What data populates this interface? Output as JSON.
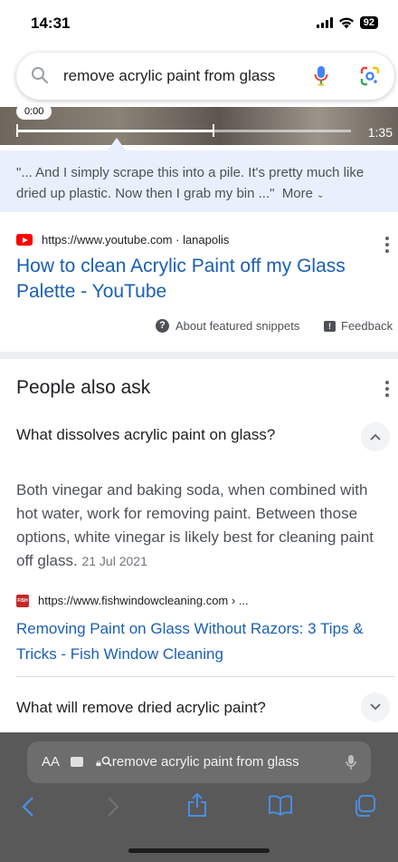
{
  "status_bar": {
    "time": "14:31",
    "battery": "92"
  },
  "search": {
    "query": "remove acrylic paint from glass"
  },
  "video": {
    "current_time": "0:00",
    "duration": "1:35",
    "progress": 0.59
  },
  "snippet": {
    "text": "\"... And I simply scrape this into a pile. It's pretty much like dried up plastic. Now then I grab my bin ...\"",
    "more_label": "More"
  },
  "result": {
    "source": "https://www.youtube.com · lanapolis",
    "title": "How to clean Acrylic Paint off my Glass Palette - YouTube"
  },
  "footer_links": {
    "about": "About featured snippets",
    "feedback": "Feedback"
  },
  "people_also_ask": {
    "heading": "People also ask",
    "q1": "What dissolves acrylic paint on glass?",
    "answer": "Both vinegar and baking soda, when combined with hot water, work for removing paint. Between those options, white vinegar is likely best for cleaning paint off glass.",
    "answer_date": "21 Jul 2021",
    "answer_source": "https://www.fishwindowcleaning.com › ...",
    "answer_title": "Removing Paint on Glass Without Razors: 3 Tips & Tricks - Fish Window Cleaning",
    "q2": "What will remove dried acrylic paint?"
  },
  "toolbar": {
    "aa": "AA",
    "address": "remove acrylic paint from glass"
  },
  "colors": {
    "link": "#1a5fb4",
    "snippet_bg": "#e8f0fe",
    "toolbar_bg": "#595959",
    "toolbar_icons": "#4a8de0"
  }
}
